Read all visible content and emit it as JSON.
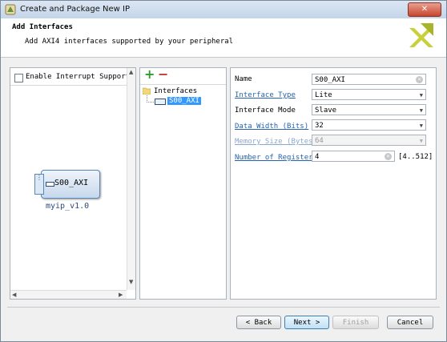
{
  "window": {
    "title": "Create and Package New IP",
    "close_glyph": "✕"
  },
  "header": {
    "title": "Add Interfaces",
    "subtitle": "Add AXI4 interfaces supported by your peripheral"
  },
  "left_panel": {
    "checkbox_label": "Enable Interrupt Support",
    "block_interface": "S00_AXI",
    "block_name": "myip_v1.0"
  },
  "tree": {
    "add_glyph": "+",
    "remove_glyph": "−",
    "root_label": "Interfaces",
    "child_label": "S00_AXI"
  },
  "form": {
    "name": {
      "label": "Name",
      "value": "S00_AXI"
    },
    "interface_type": {
      "label": "Interface Type",
      "value": "Lite"
    },
    "interface_mode": {
      "label": "Interface Mode",
      "value": "Slave"
    },
    "data_width": {
      "label": "Data Width (Bits)",
      "value": "32"
    },
    "memory_size": {
      "label": "Memory Size (Bytes)",
      "value": "64"
    },
    "num_registers": {
      "label": "Number of Registers",
      "value": "4",
      "range": "[4..512]"
    }
  },
  "buttons": {
    "back": "< Back",
    "next": "Next >",
    "finish": "Finish",
    "cancel": "Cancel"
  },
  "colors": {
    "link": "#2563b0",
    "selection": "#3399ff",
    "accent": "#3c7fb1"
  }
}
